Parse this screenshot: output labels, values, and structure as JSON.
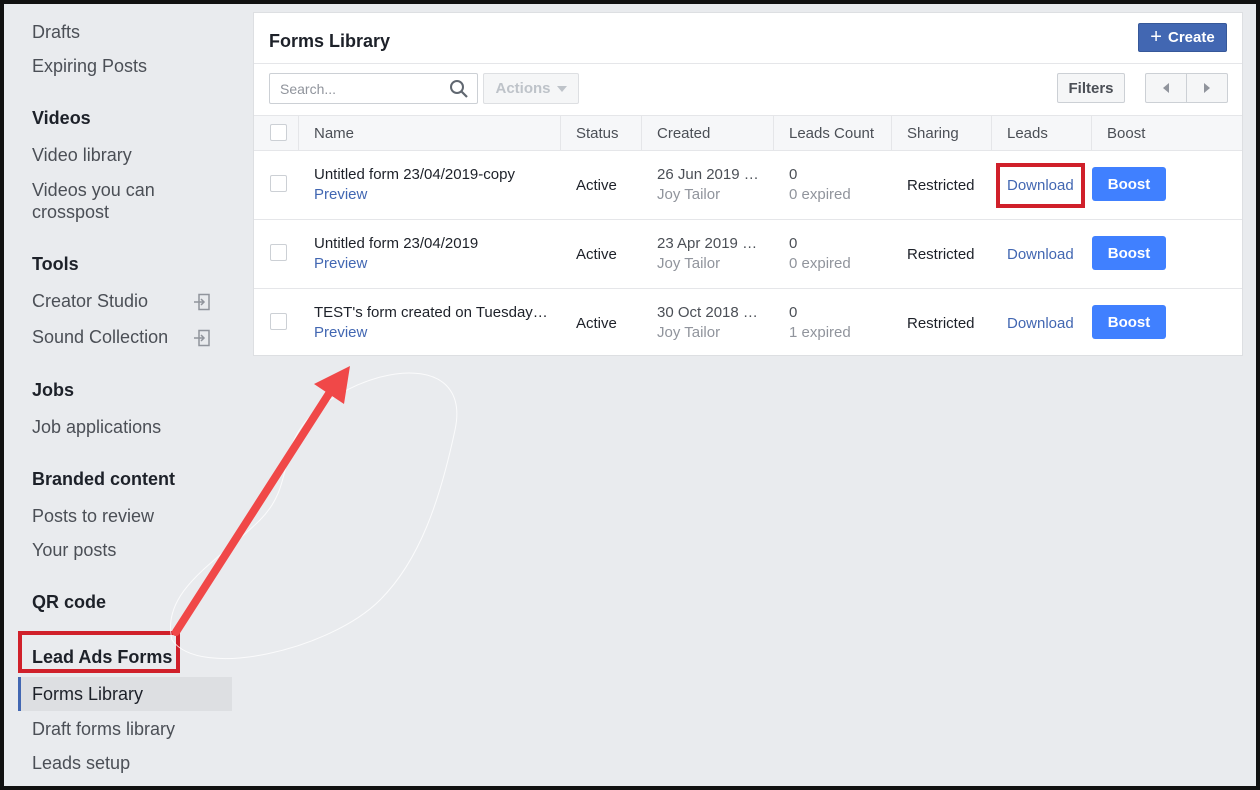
{
  "sidebar": {
    "items_top": [
      "Drafts",
      "Expiring Posts"
    ],
    "videos": {
      "heading": "Videos",
      "items": [
        "Video library",
        "Videos you can",
        "crosspost"
      ]
    },
    "tools": {
      "heading": "Tools",
      "items": [
        "Creator Studio",
        "Sound Collection"
      ]
    },
    "jobs": {
      "heading": "Jobs",
      "items": [
        "Job applications"
      ]
    },
    "branded": {
      "heading": "Branded content",
      "items": [
        "Posts to review",
        "Your posts"
      ]
    },
    "qr": {
      "heading": "QR code"
    },
    "lead_ads": {
      "heading": "Lead Ads Forms",
      "items": [
        "Forms Library",
        "Draft forms library",
        "Leads setup"
      ]
    }
  },
  "main": {
    "title": "Forms Library",
    "create_label": "Create",
    "search_placeholder": "Search...",
    "actions_label": "Actions",
    "filters_label": "Filters",
    "columns": [
      "Name",
      "Status",
      "Created",
      "Leads Count",
      "Sharing",
      "Leads",
      "Boost"
    ],
    "rows": [
      {
        "name": "Untitled form 23/04/2019-copy",
        "preview": "Preview",
        "status": "Active",
        "created": "26 Jun 2019 …",
        "creator": "Joy Tailor",
        "count": "0",
        "expired": "0 expired",
        "sharing": "Restricted",
        "leads": "Download",
        "boost": "Boost"
      },
      {
        "name": "Untitled form 23/04/2019",
        "preview": "Preview",
        "status": "Active",
        "created": "23 Apr 2019 …",
        "creator": "Joy Tailor",
        "count": "0",
        "expired": "0 expired",
        "sharing": "Restricted",
        "leads": "Download",
        "boost": "Boost"
      },
      {
        "name": "TEST's form created on Tuesday…",
        "preview": "Preview",
        "status": "Active",
        "created": "30 Oct 2018 …",
        "creator": "Joy Tailor",
        "count": "0",
        "expired": "1 expired",
        "sharing": "Restricted",
        "leads": "Download",
        "boost": "Boost"
      }
    ]
  },
  "colors": {
    "accent": "#4267b2",
    "boost": "#4080ff",
    "highlight": "#d0202a",
    "arrow": "#f04848"
  },
  "icons": [
    "search-icon",
    "chevron-down-icon",
    "chevron-left-icon",
    "chevron-right-icon",
    "plus-icon",
    "exit-icon"
  ]
}
